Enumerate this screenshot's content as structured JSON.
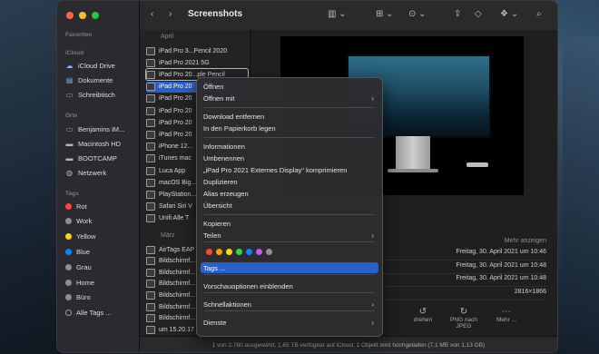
{
  "window": {
    "title": "Screenshots"
  },
  "sidebar": {
    "favorites_header": "Favoriten",
    "icloud_header": "iCloud",
    "icloud_items": [
      {
        "label": "iCloud Drive",
        "icon": "cloud-icon"
      },
      {
        "label": "Dokumente",
        "icon": "document-icon"
      },
      {
        "label": "Schreibtisch",
        "icon": "desktop-icon"
      }
    ],
    "locations_header": "Orte",
    "location_items": [
      {
        "label": "Benjamins iM...",
        "icon": "computer-icon"
      },
      {
        "label": "Macintosh HD",
        "icon": "disk-icon"
      },
      {
        "label": "BOOTCAMP",
        "icon": "disk-icon"
      },
      {
        "label": "Netzwerk",
        "icon": "network-icon"
      }
    ],
    "tags_header": "Tags",
    "tags": [
      {
        "label": "Rot",
        "color": "#ff453a"
      },
      {
        "label": "Work",
        "color": "#8e8e93"
      },
      {
        "label": "Yellow",
        "color": "#ffd60a"
      },
      {
        "label": "Blue",
        "color": "#0a84ff"
      },
      {
        "label": "Grau",
        "color": "#8e8e93"
      },
      {
        "label": "Home",
        "color": "#8e8e93"
      },
      {
        "label": "Büro",
        "color": "#8e8e93"
      },
      {
        "label": "Alle Tags ...",
        "color": "#9a9a9e"
      }
    ]
  },
  "filelist": {
    "group_april": "April",
    "april_files": [
      "iPad Pro 3...Pencil 2020",
      "iPad Pro 2021 5G",
      "iPad Pro 20...ple Pencil",
      "iPad Pro 20",
      "iPad Pro 20",
      "iPad Pro 20",
      "iPad Pro 20",
      "iPad Pro 20",
      "iPhone 12...",
      "iTunes mac",
      "Luca App",
      "macOS Big...",
      "PlayStation...",
      "Safari Siri V",
      "Unifi Alle T"
    ],
    "group_maerz": "März",
    "maerz_files": [
      "AirTags EAP",
      "Bildschirmf...",
      "Bildschirmf...",
      "Bildschirmf...",
      "Bildschirmf...",
      "Bildschirmf...",
      "Bildschirmf...",
      "um 15.20.17"
    ]
  },
  "preview": {
    "more_label": "Mehr anzeigen",
    "info_rows": [
      "Freitag, 30. April 2021 um 10:46",
      "Freitag, 30. April 2021 um 10:48",
      "Freitag, 30. April 2021 um 10:48",
      "2816×1866"
    ],
    "actions": [
      {
        "label": "drehen",
        "icon": "rotate-icon"
      },
      {
        "label": "PNG nach JPEG",
        "icon": "convert-icon"
      },
      {
        "label": "Mehr ...",
        "icon": "more-icon"
      }
    ]
  },
  "context_menu": {
    "items": [
      {
        "label": "Öffnen",
        "submenu": false
      },
      {
        "label": "Öffnen mit",
        "submenu": true
      },
      {
        "label": "Download entfernen",
        "submenu": false
      },
      {
        "label": "In den Papierkorb legen",
        "submenu": false
      },
      {
        "label": "Informationen",
        "submenu": false
      },
      {
        "label": "Umbenennen",
        "submenu": false
      },
      {
        "label": "„iPad Pro 2021 Externes Display“ komprimieren",
        "submenu": false
      },
      {
        "label": "Duplizieren",
        "submenu": false
      },
      {
        "label": "Alias erzeugen",
        "submenu": false
      },
      {
        "label": "Übersicht",
        "submenu": false
      },
      {
        "label": "Kopieren",
        "submenu": false
      },
      {
        "label": "Teilen",
        "submenu": true
      },
      {
        "label": "Tags ...",
        "submenu": false,
        "highlighted": true
      },
      {
        "label": "Vorschauoptionen einblenden",
        "submenu": false
      },
      {
        "label": "Schnellaktionen",
        "submenu": true
      },
      {
        "label": "Dienste",
        "submenu": true
      }
    ],
    "tag_colors": [
      "#ff453a",
      "#ff9f0a",
      "#ffd60a",
      "#32d74b",
      "#0a84ff",
      "#bf5af2",
      "#8e8e93"
    ]
  },
  "statusbar": {
    "text": "1 von 2.780 ausgewählt, 1,65 TB verfügbar auf iCloud, 1 Objekt wird hochgeladen (7,1 MB von 1,13 GB)"
  },
  "toolbar": {
    "icons": [
      "back-icon",
      "forward-icon",
      "column-view-icon",
      "grid-icon",
      "action-icon",
      "share-icon",
      "tag-icon",
      "dropbox-icon",
      "search-icon"
    ]
  }
}
